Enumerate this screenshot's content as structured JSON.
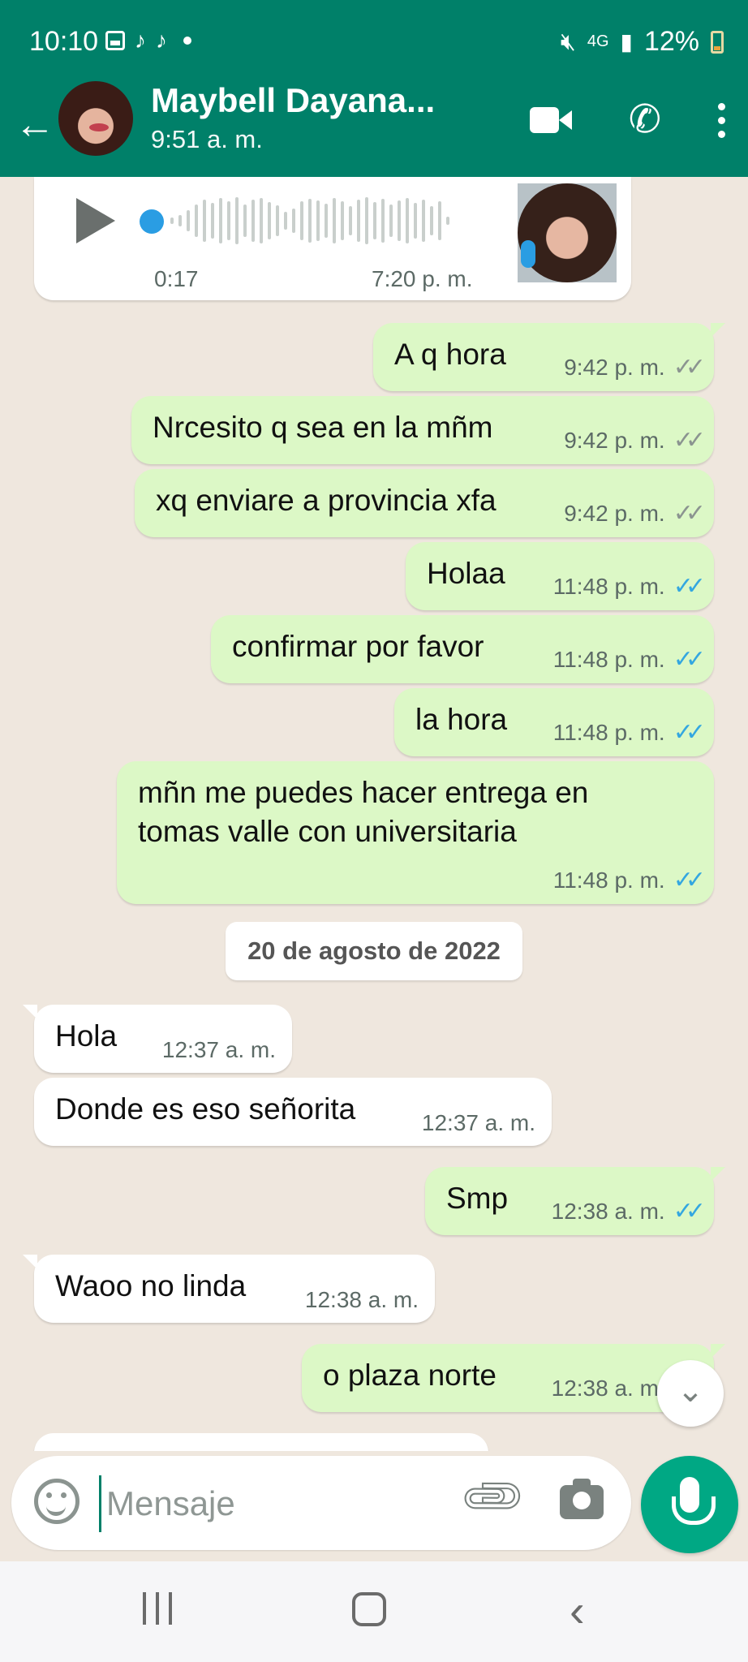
{
  "status_bar": {
    "time": "10:10",
    "network": "4G",
    "battery": "12%"
  },
  "header": {
    "contact_name": "Maybell Dayana...",
    "last_seen": "9:51 a. m."
  },
  "voice_note": {
    "duration": "0:17",
    "time": "7:20 p. m."
  },
  "messages": [
    {
      "dir": "out",
      "text": "A q hora",
      "time": "9:42 p. m.",
      "read": false
    },
    {
      "dir": "out",
      "text": "Nrcesito q sea en la mñm",
      "time": "9:42 p. m.",
      "read": false
    },
    {
      "dir": "out",
      "text": "xq enviare a provincia xfa",
      "time": "9:42 p. m.",
      "read": false
    },
    {
      "dir": "out",
      "text": "Holaa",
      "time": "11:48 p. m.",
      "read": true
    },
    {
      "dir": "out",
      "text": "confirmar por favor",
      "time": "11:48 p. m.",
      "read": true
    },
    {
      "dir": "out",
      "text": "la hora",
      "time": "11:48 p. m.",
      "read": true
    },
    {
      "dir": "out",
      "text_line1": "mñn me puedes hacer entrega en",
      "text_line2": "tomas valle con universitaria",
      "time": "11:48 p. m.",
      "read": true
    },
    {
      "dir": "in",
      "text": "Hola",
      "time": "12:37 a. m."
    },
    {
      "dir": "in",
      "text": "Donde es eso señorita",
      "time": "12:37 a. m."
    },
    {
      "dir": "out",
      "text": "Smp",
      "time": "12:38 a. m.",
      "read": true
    },
    {
      "dir": "in",
      "text": "Waoo no linda",
      "time": "12:38 a. m."
    },
    {
      "dir": "out",
      "text": "o plaza norte",
      "time": "12:38 a. m.",
      "read": true
    }
  ],
  "date_separator": "20 de agosto de 2022",
  "composer": {
    "placeholder": "Mensaje"
  },
  "icons": {
    "back": "back-arrow-icon",
    "video": "video-call-icon",
    "call": "phone-call-icon",
    "menu": "more-vert-icon",
    "emoji": "emoji-icon",
    "attach": "paperclip-icon",
    "camera": "camera-icon",
    "mic": "microphone-icon",
    "scroll": "scroll-down-icon"
  },
  "colors": {
    "header": "#008069",
    "outgoing": "#dcf8c6",
    "incoming": "#ffffff",
    "read_ticks": "#34a7e0",
    "accent": "#00a884"
  }
}
